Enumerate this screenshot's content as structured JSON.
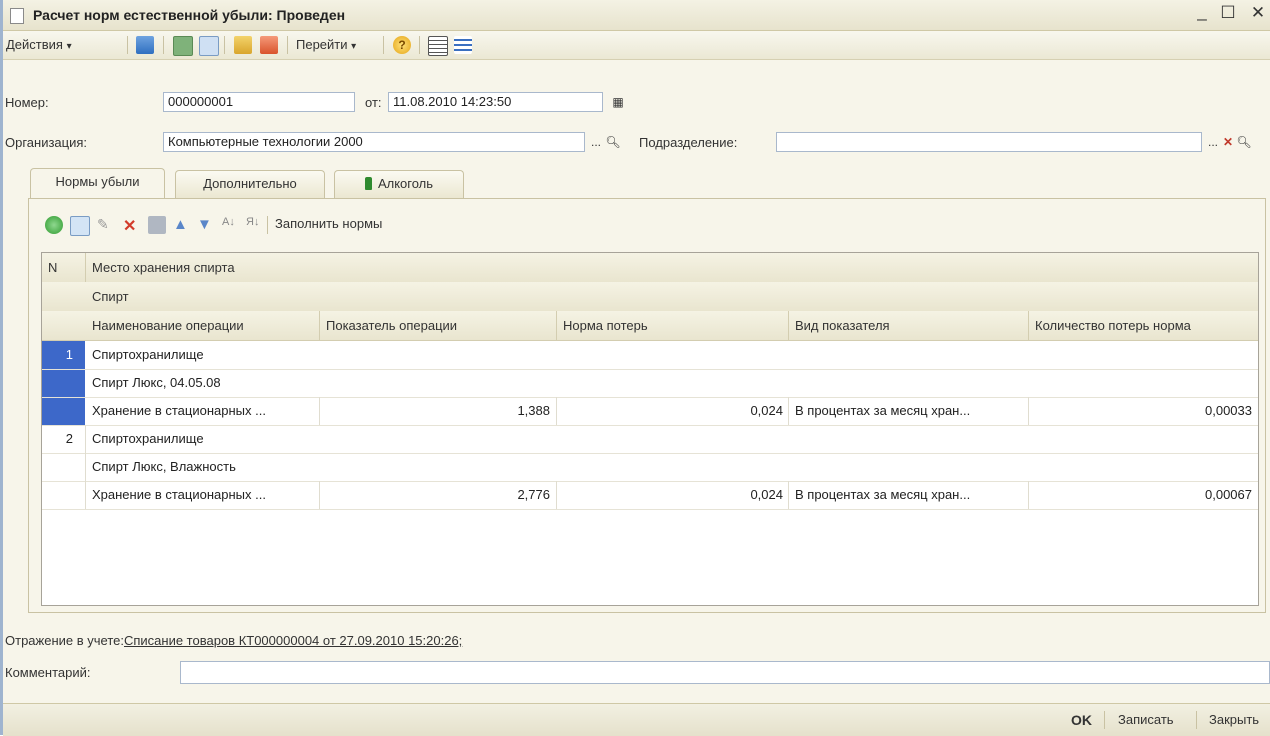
{
  "window": {
    "title": "Расчет норм естественной убыли: Проведен",
    "minimize": "_",
    "maximize": "☐",
    "close": "✕"
  },
  "toolbar": {
    "actions_label": "Действия",
    "goto_label": "Перейти",
    "dropdown_glyph": "▾"
  },
  "header": {
    "number_label": "Номер:",
    "number_value": "000000001",
    "from_label": "от:",
    "date_value": "11.08.2010 14:23:50",
    "org_label": "Организация:",
    "org_value": "Компьютерные технологии 2000",
    "dept_label": "Подразделение:",
    "dept_value": "",
    "ellipsis": "...",
    "clear": "✕"
  },
  "tabs": [
    {
      "label": "Нормы убыли"
    },
    {
      "label": "Дополнительно"
    },
    {
      "label": "Алкоголь"
    }
  ],
  "table_toolbar": {
    "fill_norms_label": "Заполнить нормы"
  },
  "table": {
    "header_row1": {
      "n": "N",
      "storage": "Место хранения спирта"
    },
    "header_row2": {
      "spirit": "Спирт"
    },
    "header_row3": [
      "Наименование операции",
      "Показатель операции",
      "Норма потерь",
      "Вид показателя",
      "Количество потерь норма"
    ],
    "rows": [
      {
        "n": "1",
        "storage": "Спиртохранилище",
        "spirit": "Спирт Люкс, 04.05.08",
        "operation": "Хранение в стационарных ...",
        "indicator": "1,388",
        "norm": "0,024",
        "kind": "В процентах за месяц хран...",
        "loss": "0,00033"
      },
      {
        "n": "2",
        "storage": "Спиртохранилище",
        "spirit": "Спирт Люкс, Влажность",
        "operation": "Хранение в стационарных ...",
        "indicator": "2,776",
        "norm": "0,024",
        "kind": "В процентах за месяц хран...",
        "loss": "0,00067"
      }
    ]
  },
  "accounting": {
    "label": "Отражение в учете:",
    "link": "Списание товаров КТ000000004 от 27.09.2010 15:20:26;"
  },
  "comment": {
    "label": "Комментарий:",
    "value": ""
  },
  "buttons": {
    "ok": "OK",
    "save": "Записать",
    "close": "Закрыть"
  },
  "colors": {
    "selection": "#3d68c9",
    "background": "#f7f5ea",
    "header_bg": "#ebe7d1"
  }
}
